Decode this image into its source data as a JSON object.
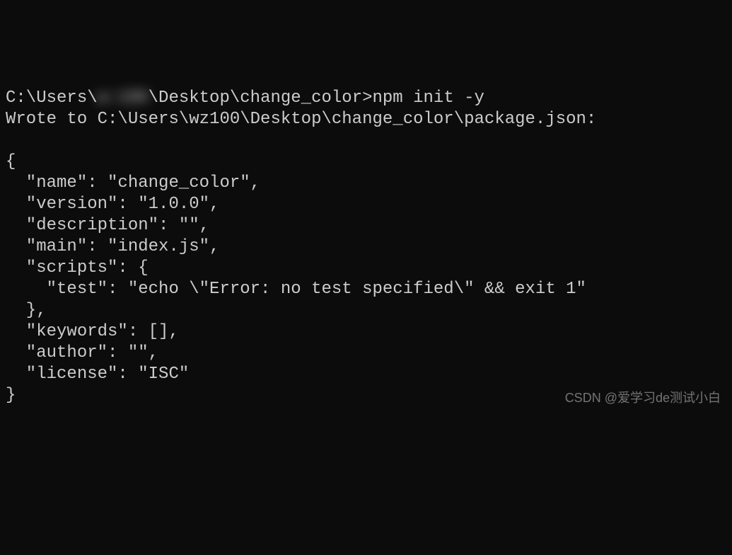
{
  "terminal": {
    "prompt_prefix": "C:\\Users\\",
    "prompt_user_censored": "w:100",
    "prompt_suffix": "\\Desktop\\change_color>",
    "command": "npm init -y",
    "output_line": "Wrote to C:\\Users\\wz100\\Desktop\\change_color\\package.json:",
    "json_lines": [
      "",
      "{",
      "  \"name\": \"change_color\",",
      "  \"version\": \"1.0.0\",",
      "  \"description\": \"\",",
      "  \"main\": \"index.js\",",
      "  \"scripts\": {",
      "    \"test\": \"echo \\\"Error: no test specified\\\" && exit 1\"",
      "  },",
      "  \"keywords\": [],",
      "  \"author\": \"\",",
      "  \"license\": \"ISC\"",
      "}"
    ]
  },
  "watermark": "CSDN @爱学习de测试小白"
}
